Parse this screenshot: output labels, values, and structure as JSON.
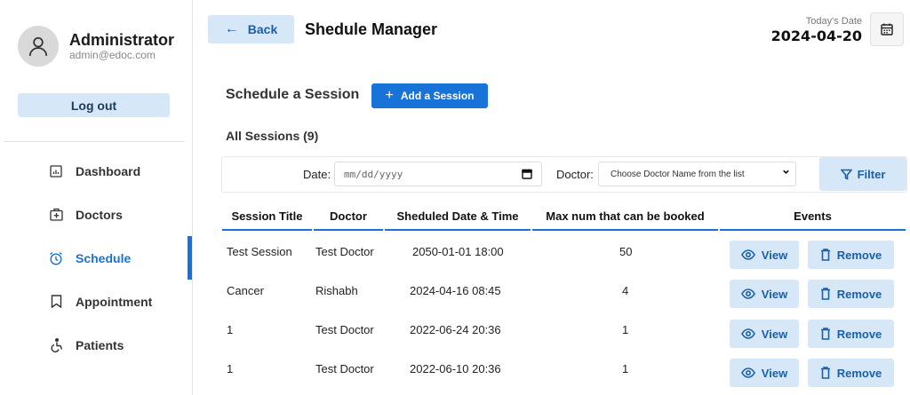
{
  "sidebar": {
    "profile": {
      "name": "Administrator",
      "email": "admin@edoc.com",
      "avatar_icon": "user-icon"
    },
    "logout_label": "Log out",
    "items": [
      {
        "label": "Dashboard",
        "icon": "dashboard-icon"
      },
      {
        "label": "Doctors",
        "icon": "doctor-bag-icon"
      },
      {
        "label": "Schedule",
        "icon": "alarm-clock-icon"
      },
      {
        "label": "Appointment",
        "icon": "bookmark-icon"
      },
      {
        "label": "Patients",
        "icon": "accessibility-icon"
      }
    ],
    "active_item": "Schedule"
  },
  "header": {
    "back_label": "Back",
    "title": "Shedule Manager",
    "date_label": "Today's Date",
    "date_value": "2024-04-20"
  },
  "main": {
    "section_title": "Schedule a Session",
    "add_label": "Add a Session",
    "all_sessions": "All Sessions (9)",
    "filter": {
      "date_label": "Date:",
      "date_placeholder": "mm/dd/yyyy",
      "doctor_label": "Doctor:",
      "doctor_select": "Choose Doctor Name from the list",
      "filter_label": "Filter"
    },
    "table": {
      "headers": [
        "Session Title",
        "Doctor",
        "Sheduled Date & Time",
        "Max num that can be booked",
        "Events"
      ],
      "rows": [
        {
          "title": "Test Session",
          "doctor": "Test Doctor",
          "datetime": "2050-01-01 18:00",
          "max": "50"
        },
        {
          "title": "Cancer",
          "doctor": "Rishabh",
          "datetime": "2024-04-16 08:45",
          "max": "4"
        },
        {
          "title": "1",
          "doctor": "Test Doctor",
          "datetime": "2022-06-24 20:36",
          "max": "1"
        },
        {
          "title": "1",
          "doctor": "Test Doctor",
          "datetime": "2022-06-10 20:36",
          "max": "1"
        }
      ],
      "view_label": "View",
      "remove_label": "Remove"
    }
  },
  "colors": {
    "accent": "#1773d8",
    "soft_button": "#d6e8f8",
    "soft_button_text": "#1b5fa8"
  }
}
